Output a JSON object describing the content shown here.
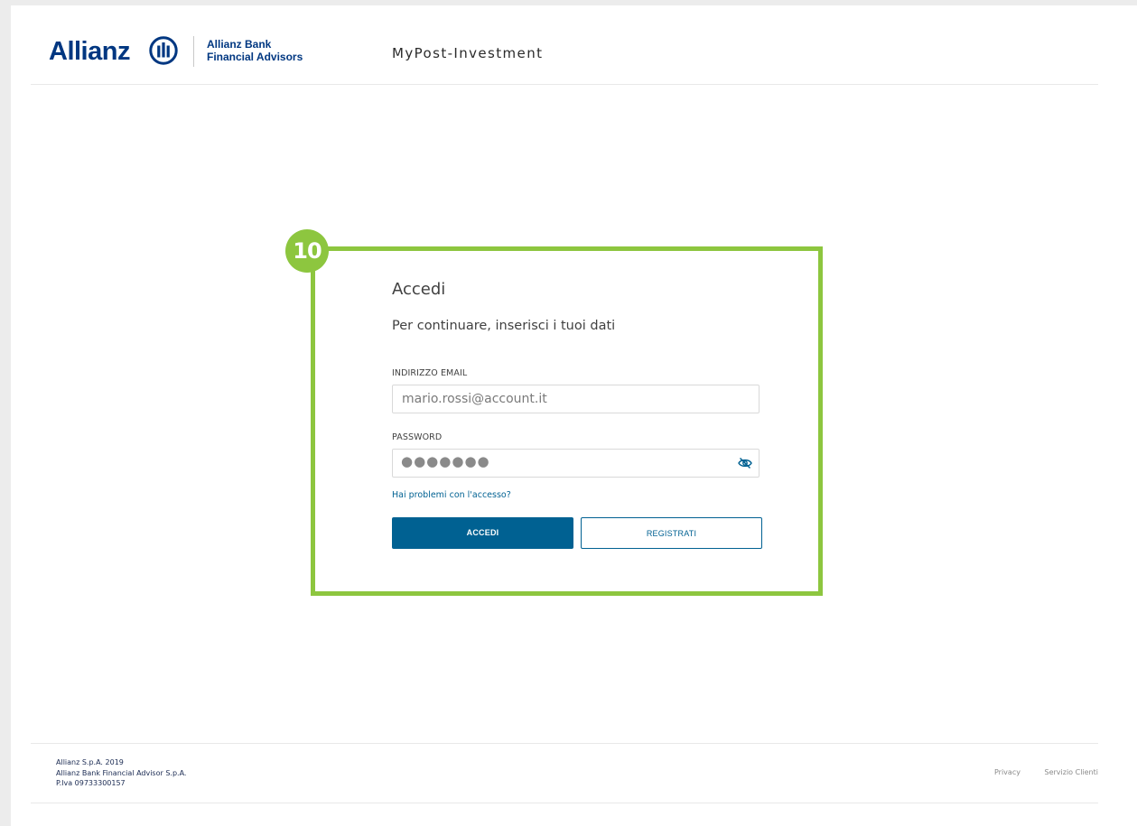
{
  "header": {
    "logo_word": "Allianz",
    "bank_name_line1": "Allianz Bank",
    "bank_name_line2": "Financial Advisors",
    "app_title": "MyPost-Investment"
  },
  "annotation": {
    "badge_number": "10",
    "color": "#8dc63f"
  },
  "login": {
    "title": "Accedi",
    "subtitle": "Per continuare, inserisci i tuoi dati",
    "email_label": "INDIRIZZO EMAIL",
    "email_value": "mario.rossi@account.it",
    "password_label": "PASSWORD",
    "password_value": "●●●●●●●",
    "show_password_icon": "eye-slash-icon",
    "help_link": "Hai problemi con l'accesso?",
    "login_button": "ACCEDI",
    "register_button": "REGISTRATI",
    "primary_color": "#006192"
  },
  "footer": {
    "line1": "Allianz S.p.A. 2019",
    "line2": "Allianz Bank Financial Advisor S.p.A.",
    "line3": "P.Iva 09733300157",
    "privacy": "Privacy",
    "customer_service": "Servizio Clienti"
  }
}
